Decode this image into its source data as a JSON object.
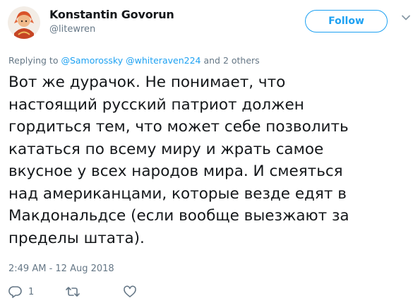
{
  "author": {
    "name": "Konstantin Govorun",
    "handle": "@litewren",
    "avatar_icon": "avatar-icon"
  },
  "follow_button": {
    "label": "Follow"
  },
  "menu_icon": "chevron-down-icon",
  "replying_to": {
    "prefix": "Replying to ",
    "mentions": [
      "@Samorossky",
      "@whiteraven224"
    ],
    "suffix": "and 2 others"
  },
  "tweet": {
    "lines": [
      "Вот же дурачок. Не понимает, что",
      "настоящий русский патриот должен",
      "гордиться тем, что может себе позволить",
      "кататься по всему миру и жрать самое",
      "вкусное у всех народов мира. И смеяться",
      "над американцами, которые везде едят в",
      "Макдональдсе (если вообще выезжают за",
      "пределы штата)."
    ],
    "timestamp": "2:49 AM - 12 Aug 2018"
  },
  "actions": {
    "reply": {
      "icon": "reply-icon",
      "count": "1"
    },
    "retweet": {
      "icon": "retweet-icon"
    },
    "like": {
      "icon": "heart-icon"
    }
  },
  "colors": {
    "accent": "#1da1f2",
    "text": "#14171a",
    "muted": "#657786"
  }
}
